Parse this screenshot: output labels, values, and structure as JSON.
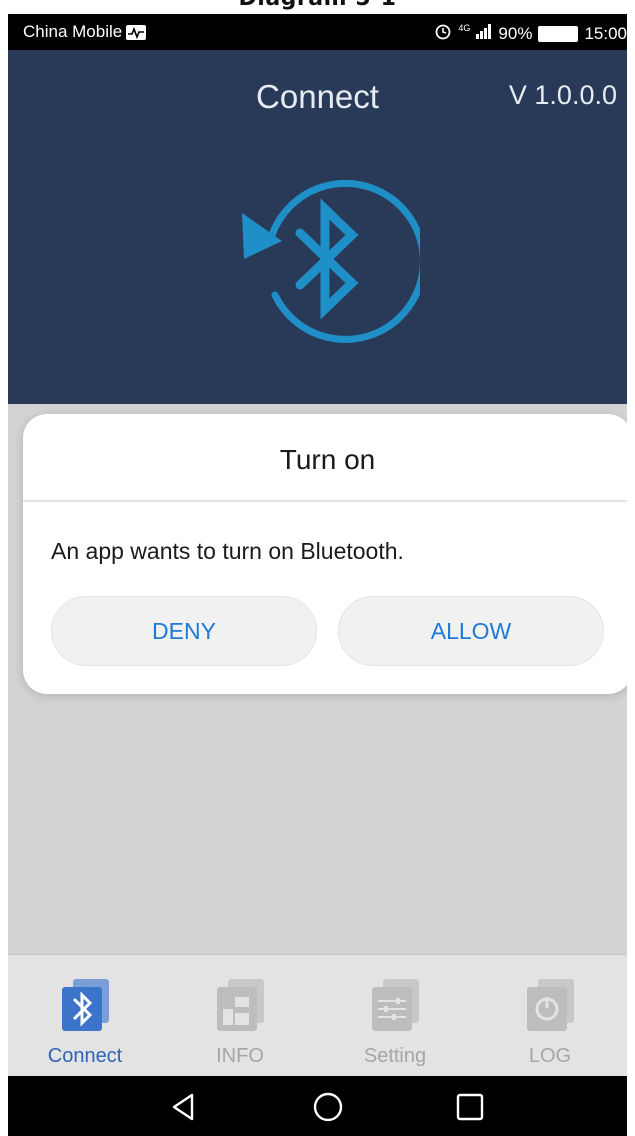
{
  "caption": "Diagram 5-1",
  "status_bar": {
    "carrier": "China Mobile",
    "signal": "4G",
    "battery": "90%",
    "time": "15:00"
  },
  "header": {
    "title": "Connect",
    "version": "V 1.0.0.0"
  },
  "dialog": {
    "title": "Turn on",
    "message": "An app wants to turn on Bluetooth.",
    "deny_label": "DENY",
    "allow_label": "ALLOW"
  },
  "tabs": [
    {
      "label": "Connect",
      "icon": "bluetooth-icon",
      "active": true
    },
    {
      "label": "INFO",
      "icon": "info-docs-icon",
      "active": false
    },
    {
      "label": "Setting",
      "icon": "sliders-icon",
      "active": false
    },
    {
      "label": "LOG",
      "icon": "log-power-icon",
      "active": false
    }
  ],
  "colors": {
    "header_bg": "#283a57",
    "accent_blue": "#1e7ad6",
    "bt_logo": "#1f8fc8",
    "tab_active": "#2e63b5"
  }
}
